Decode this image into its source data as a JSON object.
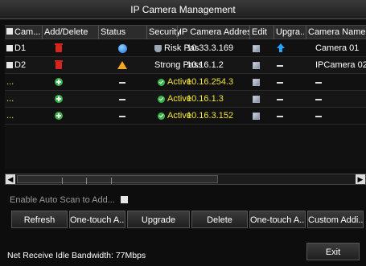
{
  "window": {
    "title": "IP Camera Management"
  },
  "table": {
    "headers": [
      "Cam...",
      "Add/Delete",
      "Status",
      "Security",
      "IP Camera Address",
      "Edit",
      "Upgra...",
      "Camera Name"
    ],
    "rows": [
      {
        "cam": "D1",
        "add_delete": "delete",
        "status": "online",
        "security": "Risk Pas...",
        "address": "10.33.3.169",
        "edit": true,
        "upgrade": "available",
        "name": "Camera 01",
        "color": "white"
      },
      {
        "cam": "D2",
        "add_delete": "delete",
        "status": "warning",
        "security": "Strong Pass...",
        "address": "10.16.1.2",
        "edit": true,
        "upgrade": "none",
        "name": "IPCamera 02",
        "color": "white"
      },
      {
        "cam": "...",
        "add_delete": "add",
        "status": "none",
        "security": "Active",
        "address": "10.16.254.3",
        "edit": true,
        "upgrade": "none",
        "name": "-",
        "color": "yellow"
      },
      {
        "cam": "...",
        "add_delete": "add",
        "status": "none",
        "security": "Active",
        "address": "10.16.1.3",
        "edit": true,
        "upgrade": "none",
        "name": "-",
        "color": "yellow"
      },
      {
        "cam": "...",
        "add_delete": "add",
        "status": "none",
        "security": "Active",
        "address": "10.16.3.152",
        "edit": true,
        "upgrade": "none",
        "name": "-",
        "color": "yellow"
      }
    ]
  },
  "auto_scan": {
    "label": "Enable Auto Scan to Add...",
    "checked": false
  },
  "buttons": [
    "Refresh",
    "One-touch A...",
    "Upgrade",
    "Delete",
    "One-touch A...",
    "Custom Addi..."
  ],
  "footer": {
    "bandwidth": "Net Receive Idle Bandwidth: 77Mbps",
    "exit_label": "Exit"
  },
  "colors": {
    "active_yellow": "#f2e63a",
    "delete_red": "#d6251b",
    "add_green": "#39b54a",
    "online_blue": "#1a73d9",
    "warning_orange": "#f5a623"
  }
}
